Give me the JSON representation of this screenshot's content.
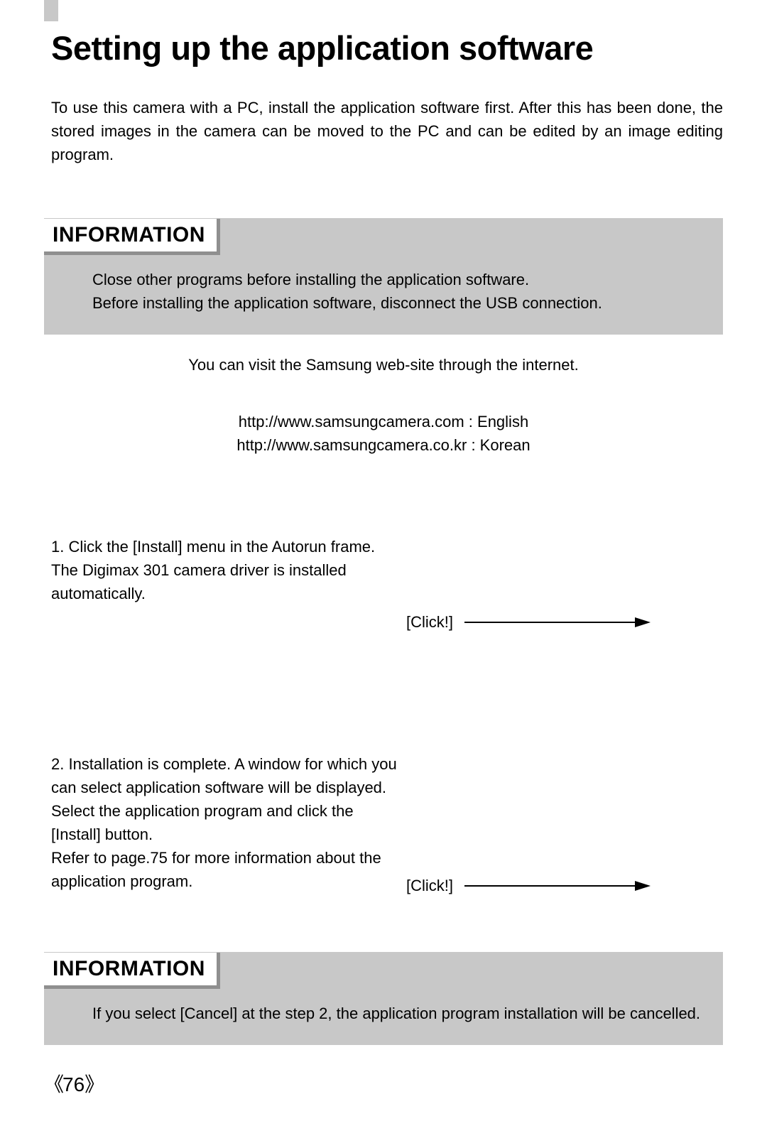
{
  "page": {
    "title": "Setting up the application software",
    "intro": "To use this camera with a PC, install the application software first. After this has been done, the stored images in the camera can be moved to the PC and can be edited by an image editing program.",
    "page_number": "76"
  },
  "info1": {
    "heading": "INFORMATION",
    "line1": "Close other programs before installing the application software.",
    "line2": "Before installing the application software, disconnect the USB connection."
  },
  "mid": {
    "visit": "You can visit the Samsung web-site through the internet.",
    "url1": "http://www.samsungcamera.com : English",
    "url2": "http://www.samsungcamera.co.kr : Korean"
  },
  "steps": {
    "s1": "1. Click the [Install] menu in the Autorun frame. The Digimax 301 camera driver is installed automatically.",
    "s1_click": "[Click!]",
    "s2": "2. Installation is complete. A window for which you can select application software will be displayed. Select the application program and click the [Install] button.\nRefer to page.75 for more information about the application program.",
    "s2_click": "[Click!]"
  },
  "info2": {
    "heading": "INFORMATION",
    "body": "If you select [Cancel] at the step 2, the application program installation will be cancelled."
  }
}
